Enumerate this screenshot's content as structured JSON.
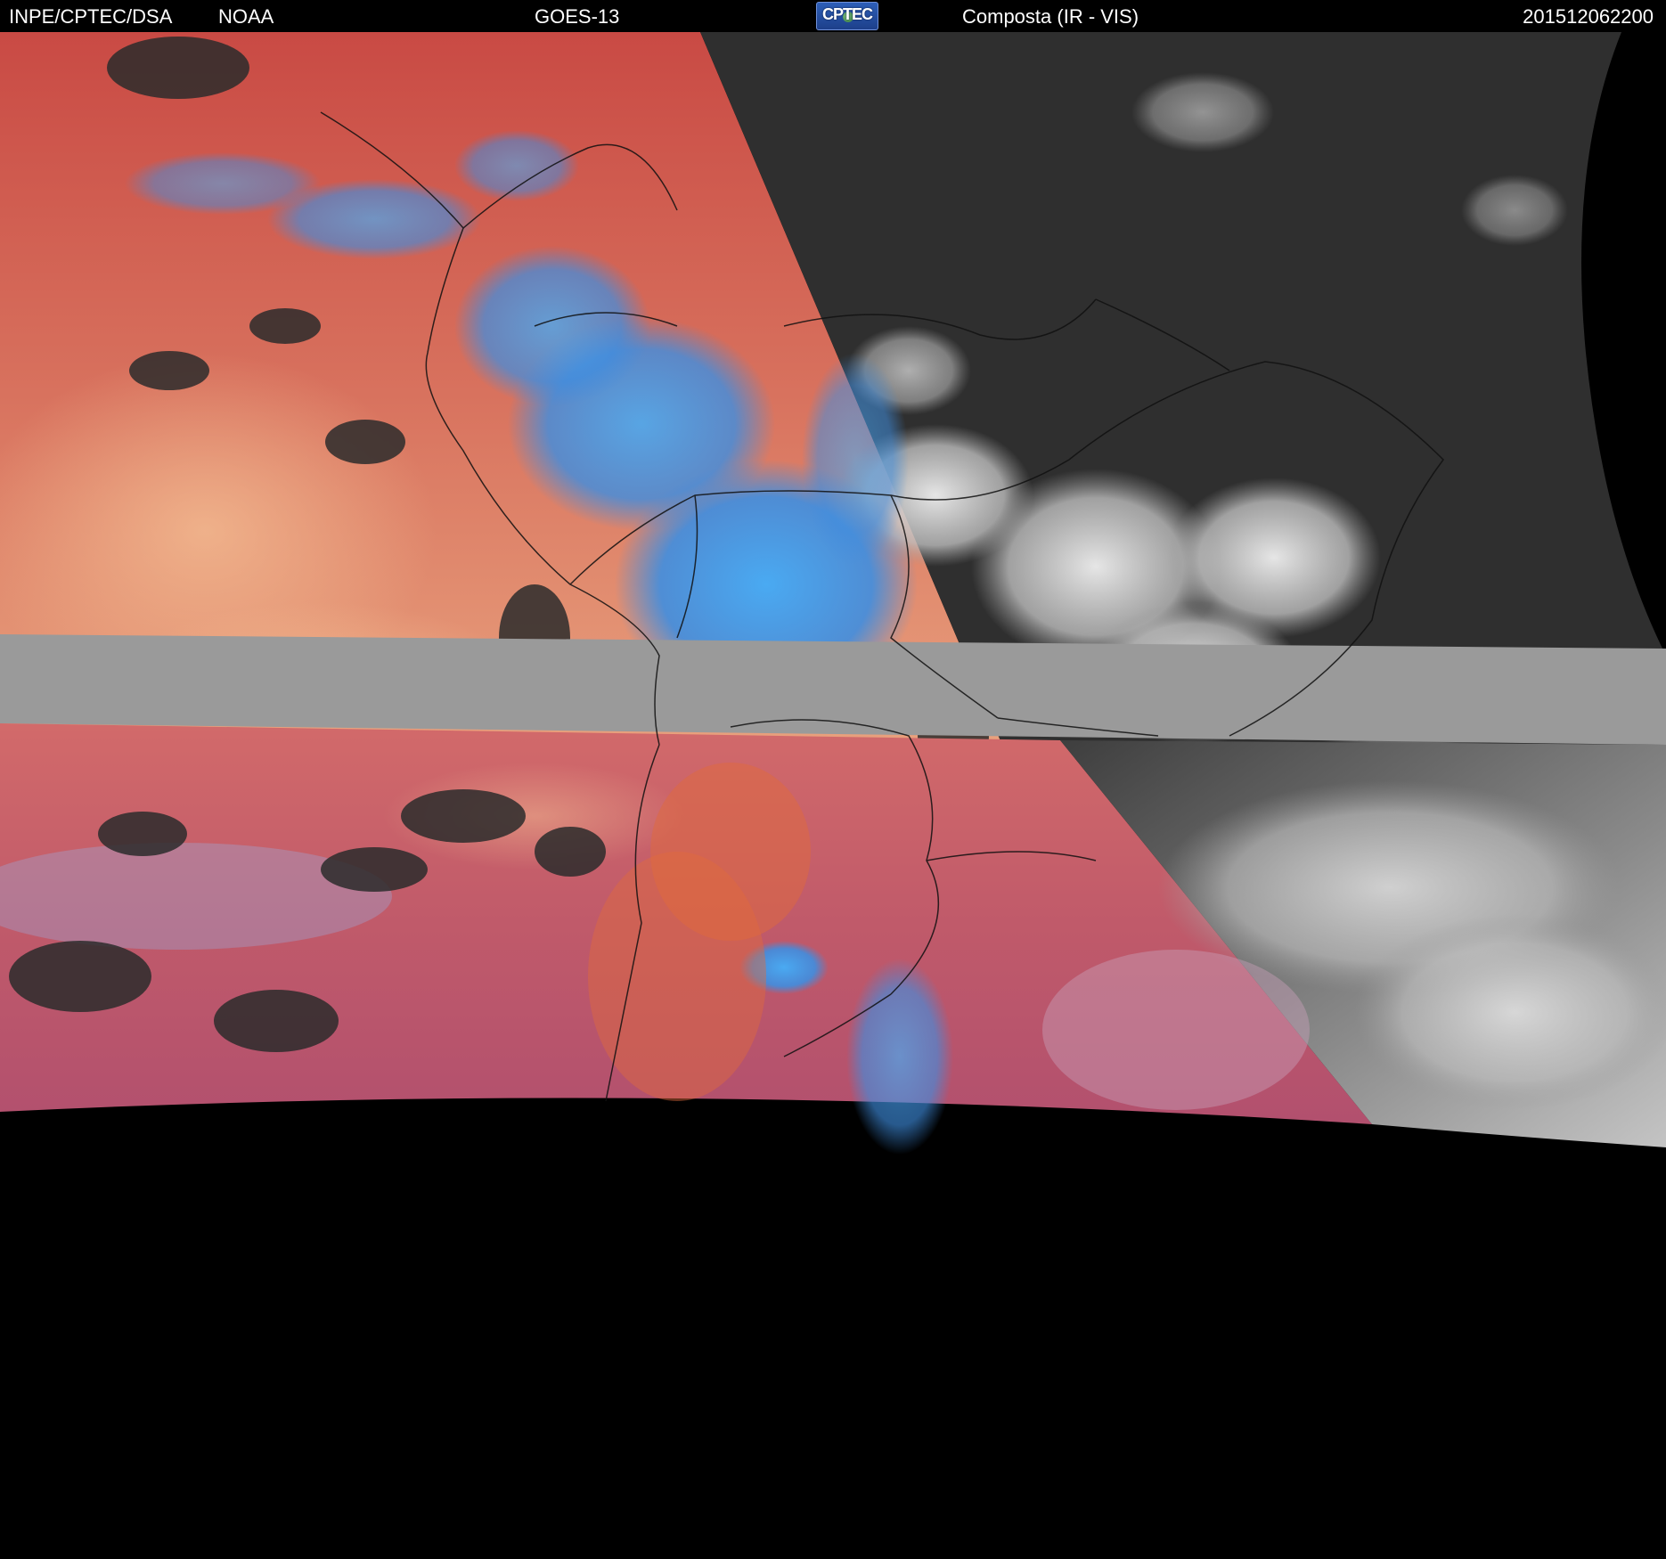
{
  "header": {
    "agency": "INPE/CPTEC/DSA",
    "source": "NOAA",
    "satellite": "GOES-13",
    "logo_text": "CPTEC",
    "product": "Composta (IR - VIS)",
    "timestamp": "201512062200"
  },
  "colors": {
    "ir_red": "#c8504a",
    "ir_salmon": "#e0867a",
    "ir_peach": "#f0b08a",
    "cold_cloud_blue": "#46a8f0",
    "cloud_cyan": "#7ae8e8",
    "vis_dark": "#2e2e2e",
    "vis_cloud": "#d8d8d8",
    "missing_band": "#9a9a9a",
    "space": "#000000"
  }
}
